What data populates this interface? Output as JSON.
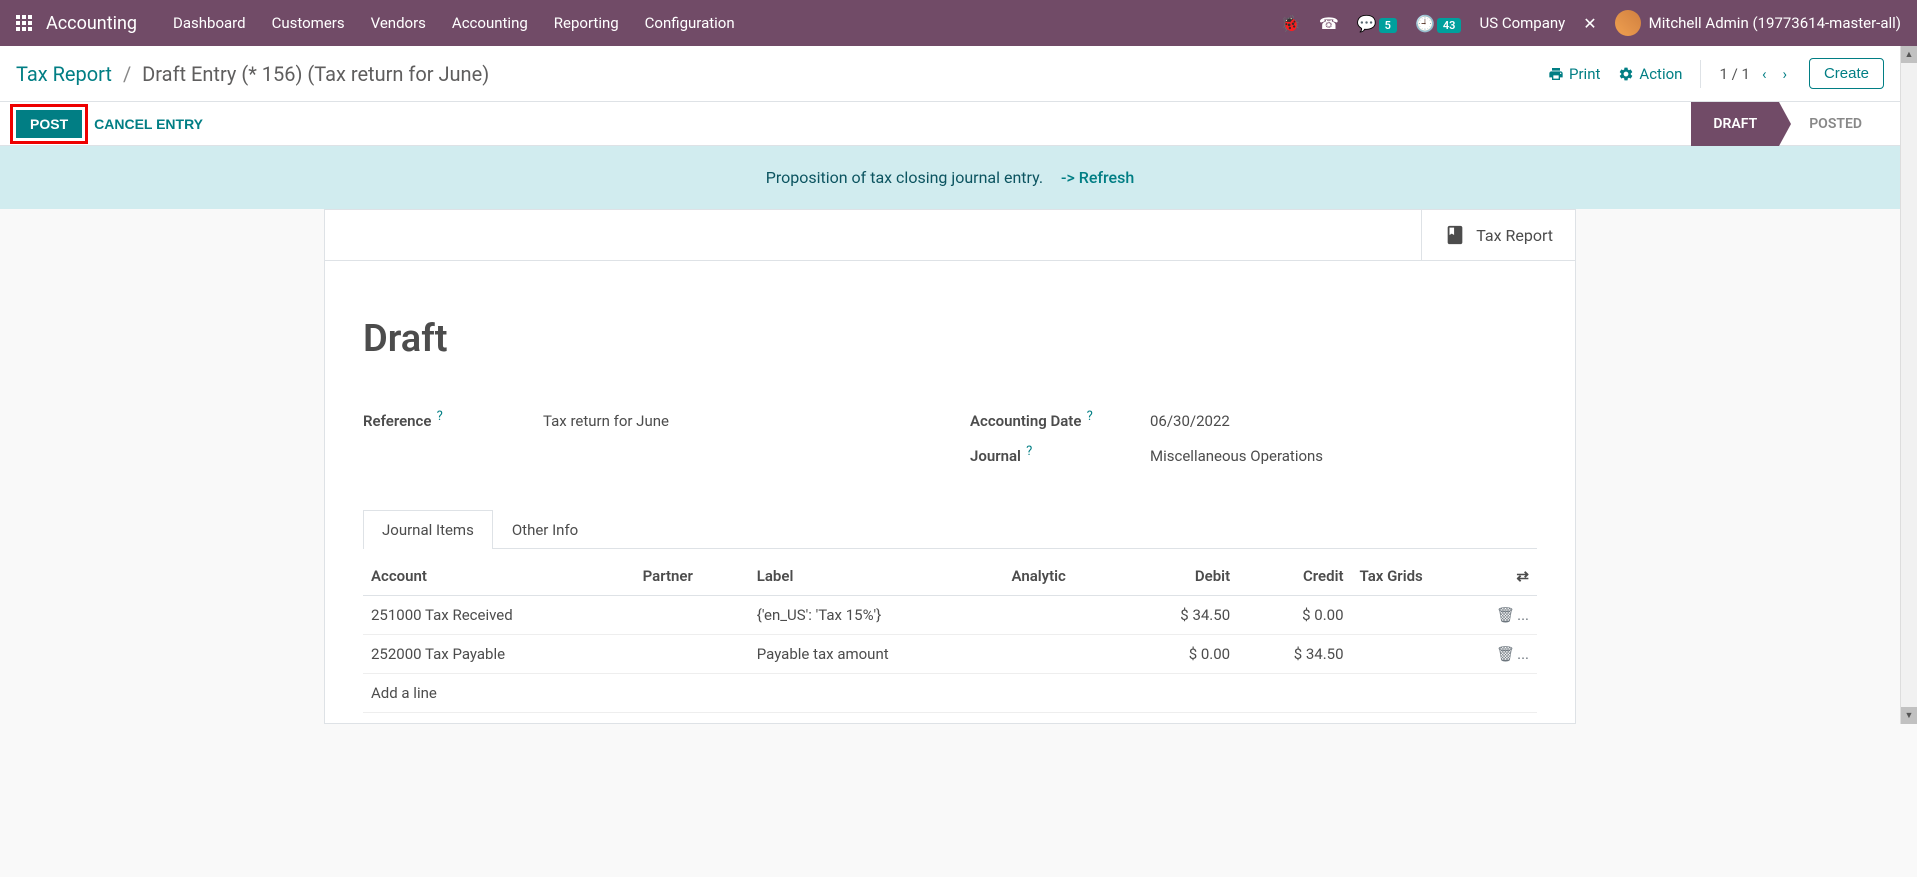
{
  "topnav": {
    "brand": "Accounting",
    "menu": [
      "Dashboard",
      "Customers",
      "Vendors",
      "Accounting",
      "Reporting",
      "Configuration"
    ],
    "messages_badge": "5",
    "activities_badge": "43",
    "company": "US Company",
    "user": "Mitchell Admin (19773614-master-all)"
  },
  "breadcrumb": {
    "root": "Tax Report",
    "current": "Draft Entry (* 156) (Tax return for June)"
  },
  "controls": {
    "print": "Print",
    "action": "Action",
    "pager": "1 / 1",
    "create": "Create"
  },
  "statusrow": {
    "post": "POST",
    "cancel": "CANCEL ENTRY",
    "stage_active": "DRAFT",
    "stage_next": "POSTED"
  },
  "banner": {
    "text": "Proposition of tax closing journal entry.",
    "refresh": "-> Refresh"
  },
  "statbtn": {
    "tax_report": "Tax Report"
  },
  "form": {
    "title": "Draft",
    "labels": {
      "reference": "Reference",
      "accounting_date": "Accounting Date",
      "journal": "Journal"
    },
    "values": {
      "reference": "Tax return for June",
      "accounting_date": "06/30/2022",
      "journal": "Miscellaneous Operations"
    }
  },
  "tabs": {
    "journal_items": "Journal Items",
    "other_info": "Other Info"
  },
  "table": {
    "headers": {
      "account": "Account",
      "partner": "Partner",
      "label": "Label",
      "analytic": "Analytic",
      "debit": "Debit",
      "credit": "Credit",
      "tax_grids": "Tax Grids"
    },
    "rows": [
      {
        "account": "251000 Tax Received",
        "partner": "",
        "label": "{'en_US': 'Tax 15%'}",
        "analytic": "",
        "debit": "$ 34.50",
        "credit": "$ 0.00",
        "tax_grids": ""
      },
      {
        "account": "252000 Tax Payable",
        "partner": "",
        "label": "Payable tax amount",
        "analytic": "",
        "debit": "$ 0.00",
        "credit": "$ 34.50",
        "tax_grids": ""
      }
    ],
    "add_line": "Add a line"
  }
}
